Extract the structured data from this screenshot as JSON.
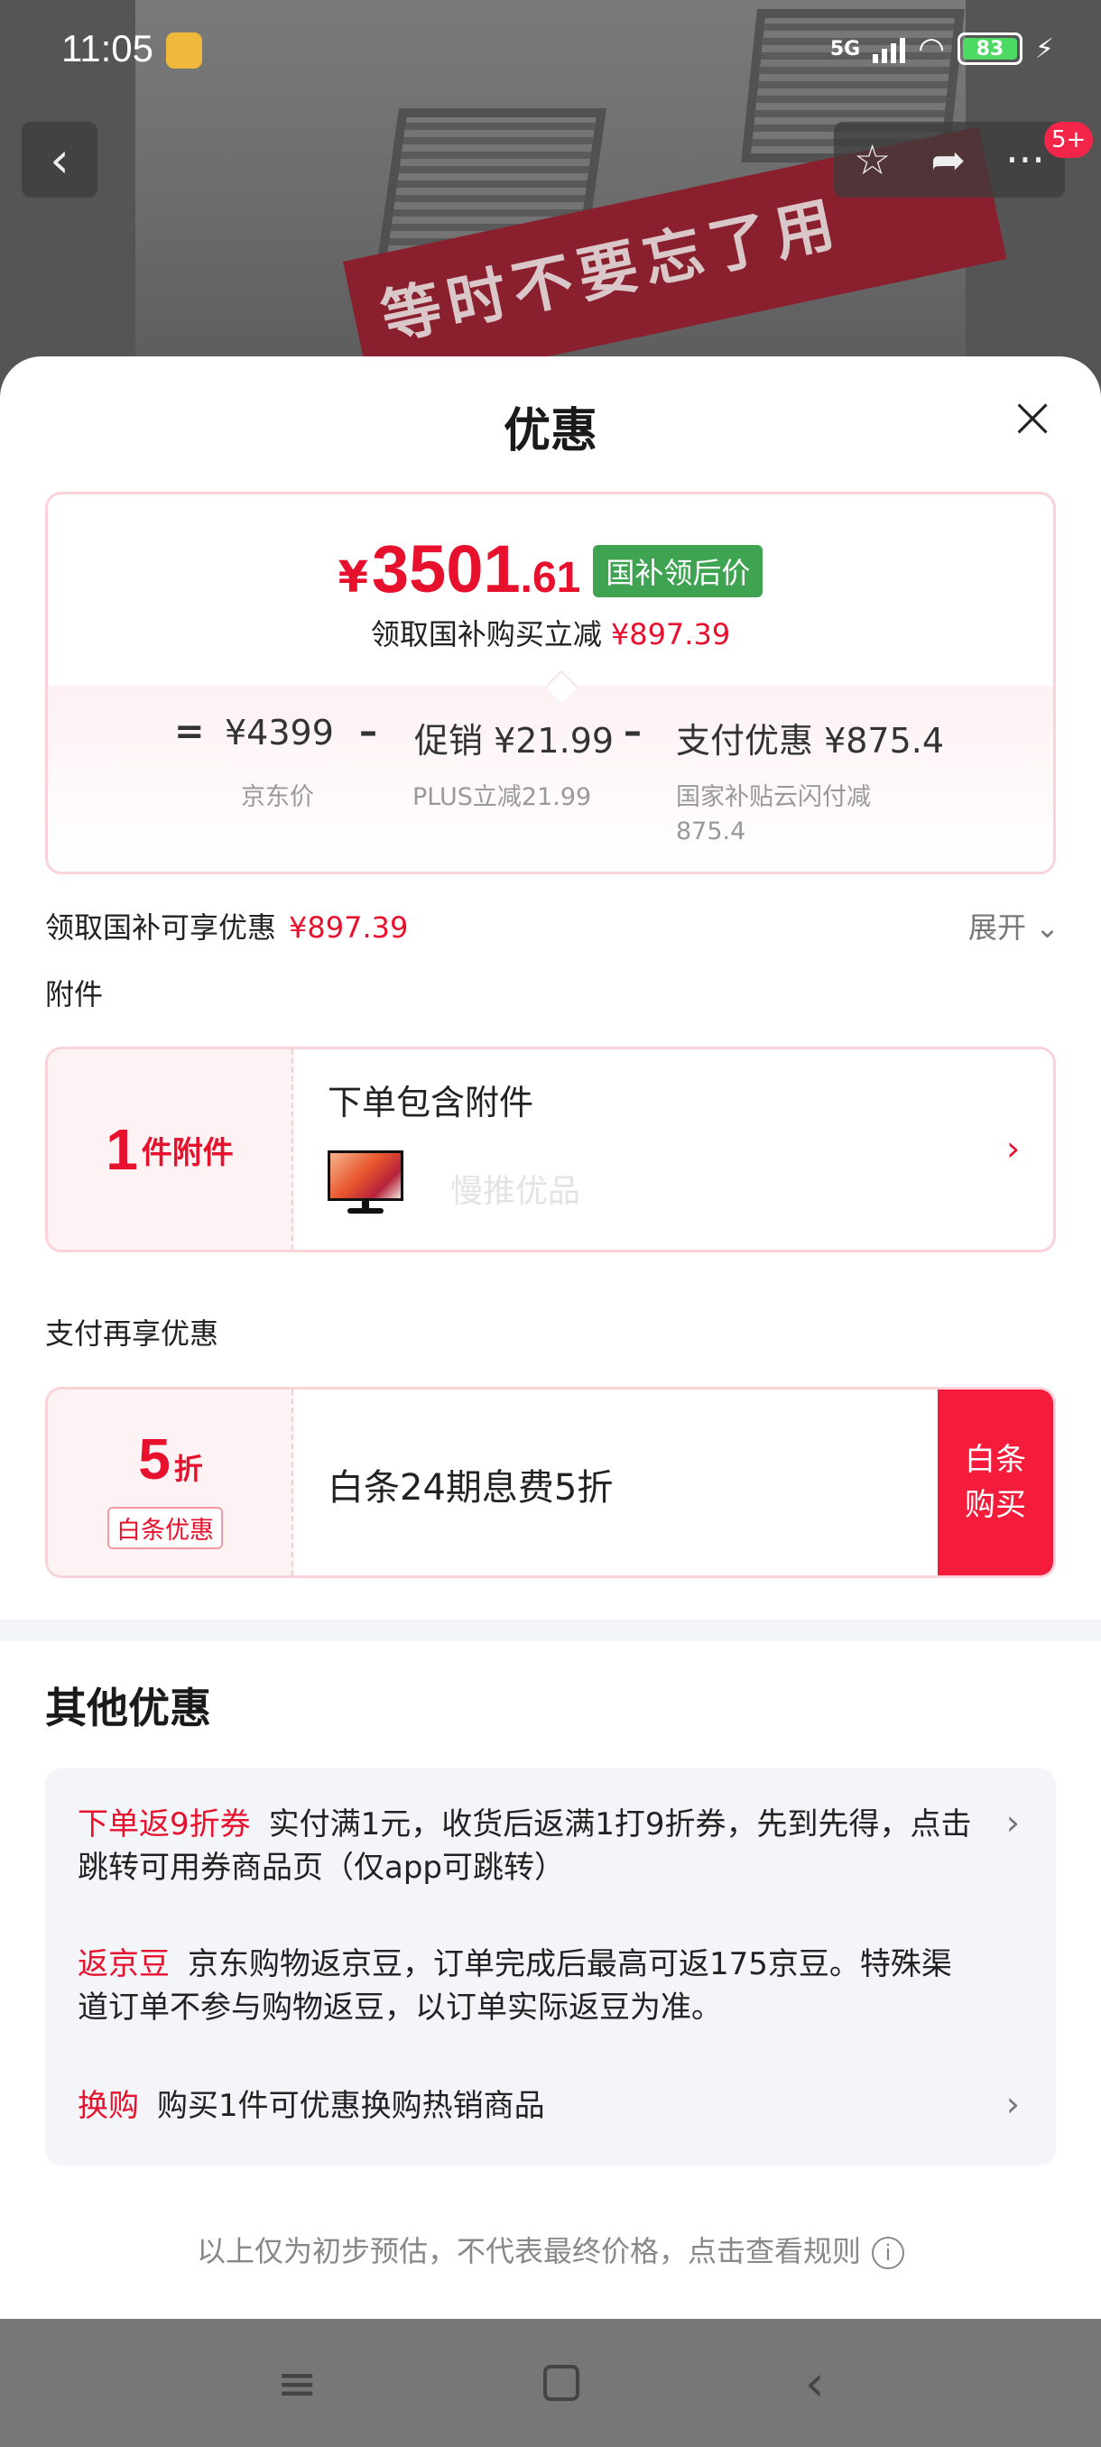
{
  "status_bar": {
    "time": "11:05",
    "network": "5G",
    "battery": "83"
  },
  "background": {
    "banner_text": "等时不要忘了用"
  },
  "top_actions": {
    "badge": "5+"
  },
  "sheet": {
    "title": "优惠",
    "price": {
      "currency": "¥",
      "integer": "3501",
      "decimal": ".61",
      "tag": "国补领后价",
      "sub_label": "领取国补购买立减",
      "sub_amount": "¥897.39",
      "breakdown": {
        "eq": "=",
        "item1_value": "¥4399",
        "item1_label": "京东价",
        "minus1": "–",
        "item2_value": "促销 ¥21.99",
        "item2_label": "PLUS立减21.99",
        "minus2": "–",
        "item3_value": "支付优惠 ¥875.4",
        "item3_label_line1": "国家补贴云闪付减",
        "item3_label_line2": "875.4"
      }
    },
    "discount": {
      "label": "领取国补可享优惠",
      "amount": "¥897.39",
      "expand": "展开 ⌄"
    },
    "accessory": {
      "section": "附件",
      "count": "1",
      "unit": "件附件",
      "title": "下单包含附件",
      "name": "慢推优品"
    },
    "payment": {
      "section": "支付再享优惠",
      "discount_num": "5",
      "discount_unit": "折",
      "tag": "白条优惠",
      "text": "白条24期息费5折",
      "button": "白条购买"
    },
    "other": {
      "title": "其他优惠",
      "items": [
        {
          "tag": "下单返9折券",
          "text": "实付满1元，收货后返满1打9折券，先到先得，点击跳转可用券商品页（仅app可跳转）"
        },
        {
          "tag": "返京豆",
          "text": "京东购物返京豆，订单完成后最高可返175京豆。特殊渠道订单不参与购物返豆，以订单实际返豆为准。"
        },
        {
          "tag": "换购",
          "text": "购买1件可优惠换购热销商品"
        }
      ]
    },
    "footnote": "以上仅为初步预估，不代表最终价格，点击查看规则"
  },
  "colors": {
    "accent": "#e8112d",
    "tag_green": "#3ea452",
    "button_red": "#f41c3a"
  }
}
